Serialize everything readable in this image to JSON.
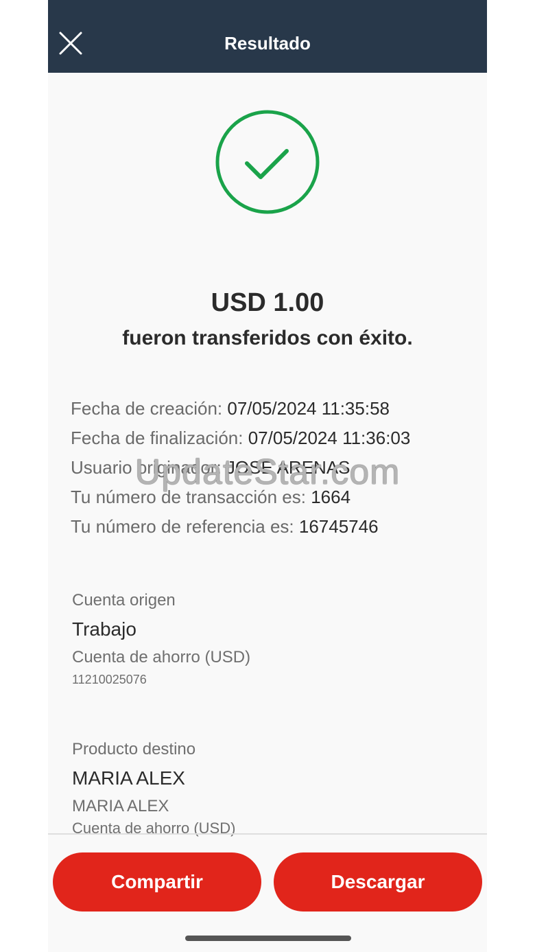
{
  "header": {
    "title": "Resultado",
    "close_icon": "close-icon"
  },
  "result": {
    "status_icon": "check-circle-icon",
    "amount": "USD 1.00",
    "message": "fueron transferidos con éxito."
  },
  "details": [
    {
      "label": "Fecha de creación: ",
      "value": "07/05/2024 11:35:58"
    },
    {
      "label": "Fecha de finalización: ",
      "value": "07/05/2024 11:36:03"
    },
    {
      "label": "Usuario originador: ",
      "value": "JOSE ARENAS"
    },
    {
      "label": "Tu número de transacción es: ",
      "value": "1664"
    },
    {
      "label": "Tu número de referencia es: ",
      "value": "16745746"
    }
  ],
  "watermark": "UpdateStar.com",
  "origin": {
    "label": "Cuenta origen",
    "name": "Trabajo",
    "account_type": "Cuenta de ahorro (USD)",
    "account_number": "11210025076"
  },
  "destination": {
    "label": "Producto destino",
    "name": "MARIA ALEX",
    "holder": "MARIA ALEX",
    "account_type": "Cuenta de ahorro (USD)"
  },
  "actions": {
    "share_label": "Compartir",
    "download_label": "Descargar"
  },
  "colors": {
    "header_bg": "#28384a",
    "success_green": "#1aa34a",
    "accent_red": "#e1251b"
  }
}
